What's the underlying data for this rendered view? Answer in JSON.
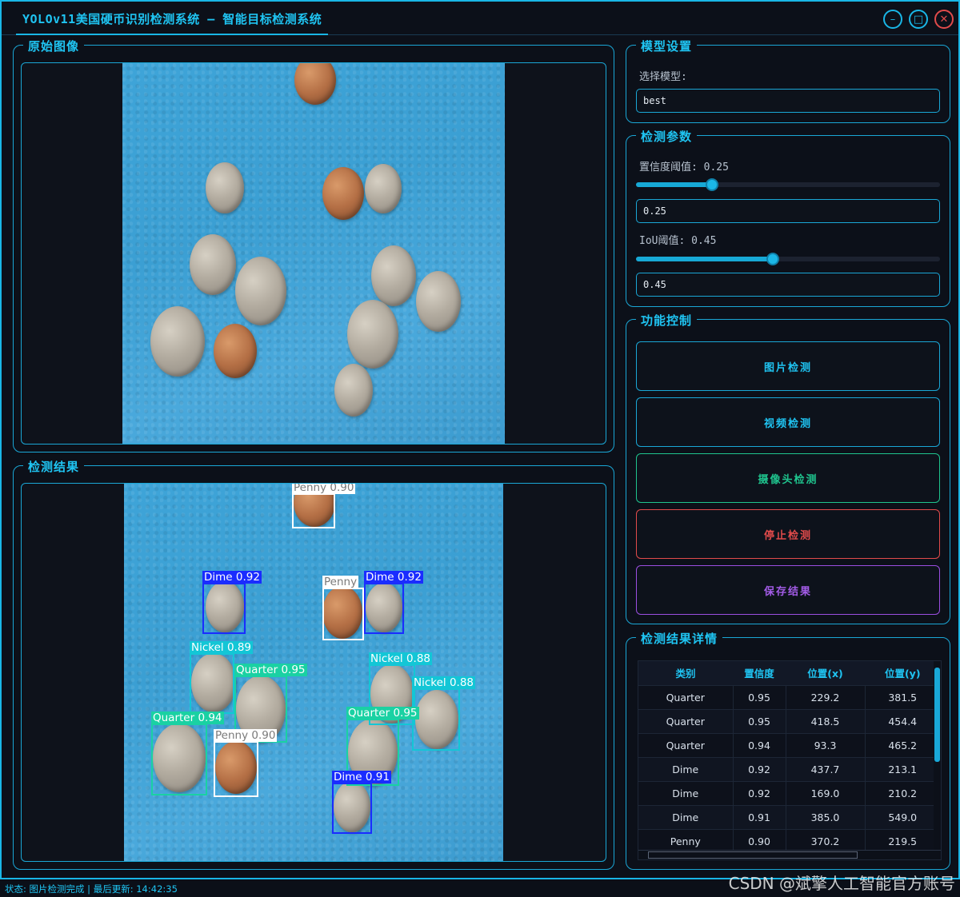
{
  "window": {
    "title": "YOLOv11美国硬币识别检测系统 – 智能目标检测系统",
    "minimize_symbol": "–",
    "maximize_symbol": "□",
    "close_symbol": "✕"
  },
  "panels": {
    "original": {
      "title": "原始图像"
    },
    "result": {
      "title": "检测结果"
    },
    "model": {
      "title": "模型设置",
      "select_label": "选择模型:",
      "model_value": "best"
    },
    "params": {
      "title": "检测参数",
      "conf_label": "置信度阈值: 0.25",
      "conf_value": "0.25",
      "conf_fraction": 0.25,
      "iou_label": "IoU阈值: 0.45",
      "iou_value": "0.45",
      "iou_fraction": 0.45
    },
    "controls": {
      "title": "功能控制",
      "image_detect": "图片检测",
      "video_detect": "视频检测",
      "camera_detect": "摄像头检测",
      "stop_detect": "停止检测",
      "save_result": "保存结果"
    },
    "details": {
      "title": "检测结果详情",
      "columns": [
        "类别",
        "置信度",
        "位置(x)",
        "位置(y)"
      ],
      "rows": [
        [
          "Quarter",
          "0.95",
          "229.2",
          "381.5"
        ],
        [
          "Quarter",
          "0.95",
          "418.5",
          "454.4"
        ],
        [
          "Quarter",
          "0.94",
          "93.3",
          "465.2"
        ],
        [
          "Dime",
          "0.92",
          "437.7",
          "213.1"
        ],
        [
          "Dime",
          "0.92",
          "169.0",
          "210.2"
        ],
        [
          "Dime",
          "0.91",
          "385.0",
          "549.0"
        ],
        [
          "Penny",
          "0.90",
          "370.2",
          "219.5"
        ]
      ]
    }
  },
  "detections": [
    {
      "label": "Penny 0.90",
      "color": "#ffffff",
      "text_color": "#7a7a7a"
    },
    {
      "label": "Dime 0.92",
      "color": "#1a2cff",
      "text_color": "#ffffff"
    },
    {
      "label": "Penny",
      "color": "#ffffff",
      "text_color": "#7a7a7a"
    },
    {
      "label": "Dime 0.92",
      "color": "#1a2cff",
      "text_color": "#ffffff"
    },
    {
      "label": "Nickel 0.89",
      "color": "#13c6d6",
      "text_color": "#ffffff"
    },
    {
      "label": "Quarter 0.95",
      "color": "#1ad1a3",
      "text_color": "#ffffff"
    },
    {
      "label": "Nickel 0.88",
      "color": "#13c6d6",
      "text_color": "#ffffff"
    },
    {
      "label": "Nickel 0.88",
      "color": "#13c6d6",
      "text_color": "#ffffff"
    },
    {
      "label": "Quarter 0.94",
      "color": "#1ad1a3",
      "text_color": "#ffffff"
    },
    {
      "label": "Penny 0.90",
      "color": "#ffffff",
      "text_color": "#7a7a7a"
    },
    {
      "label": "Quarter 0.95",
      "color": "#1ad1a3",
      "text_color": "#ffffff"
    },
    {
      "label": "Dime 0.91",
      "color": "#1a2cff",
      "text_color": "#ffffff"
    }
  ],
  "status": "状态: 图片检测完成 | 最后更新: 14:42:35",
  "watermark": "CSDN @斌擎人工智能官方账号",
  "colors": {
    "accent": "#19b6e6",
    "image_btn": "#1aa7d6",
    "camera_btn": "#1fc48e",
    "stop_btn": "#e14b4b",
    "save_btn": "#9b4ee0"
  }
}
